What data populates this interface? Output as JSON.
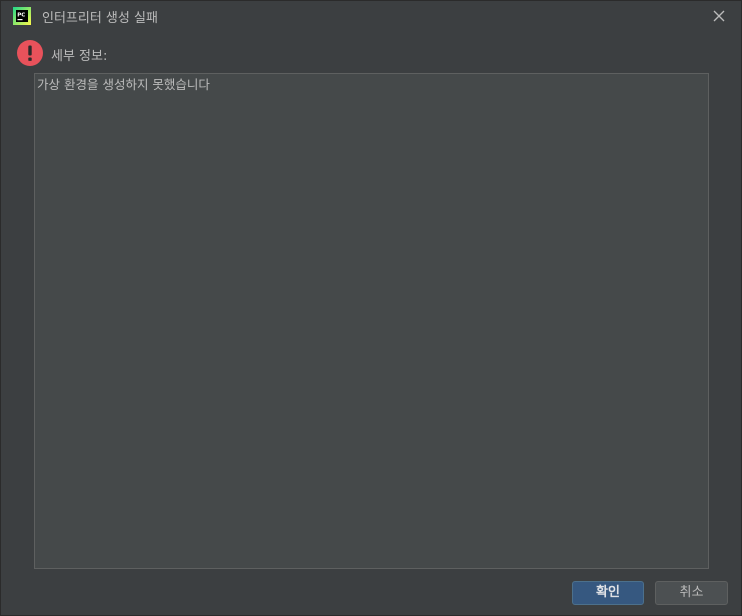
{
  "window": {
    "title": "인터프리터 생성 실패",
    "app_icon": "pycharm-icon",
    "close_icon": "close-icon"
  },
  "message": {
    "icon": "error-icon",
    "label": "세부 정보:",
    "details_text": "가상 환경을 생성하지 못했습니다"
  },
  "buttons": {
    "ok_label": "확인",
    "cancel_label": "취소"
  },
  "colors": {
    "background": "#3c3f41",
    "details_background": "#45494a",
    "primary_button": "#365880",
    "error_red": "#e8525b"
  }
}
